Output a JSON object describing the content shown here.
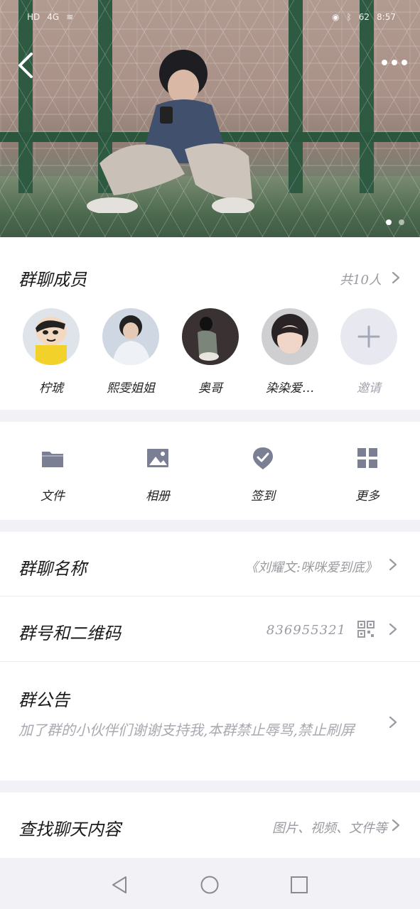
{
  "status_bar": {
    "network": "HD",
    "signal": "4G",
    "battery": "62",
    "time": "8:57"
  },
  "hero": {
    "page_count": 2,
    "active_page": 0
  },
  "members": {
    "title": "群聊成员",
    "count": "共10人",
    "list": [
      {
        "name": "柠琥"
      },
      {
        "name": "熙雯姐姐"
      },
      {
        "name": "奥哥"
      },
      {
        "name": "染染爱…"
      }
    ],
    "invite_label": "邀请"
  },
  "tools": [
    {
      "label": "文件",
      "icon": "folder-icon"
    },
    {
      "label": "相册",
      "icon": "image-icon"
    },
    {
      "label": "签到",
      "icon": "check-badge-icon"
    },
    {
      "label": "更多",
      "icon": "grid-icon"
    }
  ],
  "group_name": {
    "label": "群聊名称",
    "value": "《刘耀文:咪咪爱到底》"
  },
  "group_id": {
    "label": "群号和二维码",
    "value": "836955321"
  },
  "notice": {
    "label": "群公告",
    "text": "加了群的小伙伴们谢谢支持我,本群禁止辱骂,禁止刷屏"
  },
  "search": {
    "label": "查找聊天内容",
    "hint": "图片、视频、文件等"
  },
  "colors": {
    "accent": "#7a7f94",
    "subtext": "#9a9aa0",
    "background": "#f2f2f6"
  }
}
